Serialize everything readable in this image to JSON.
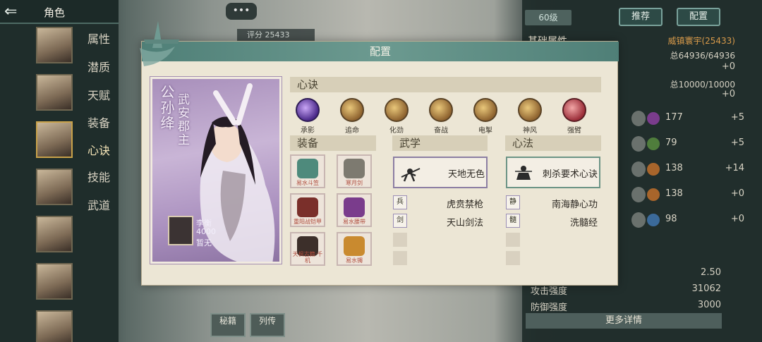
{
  "topbar": {
    "title": "角色",
    "back_icon": "back-arrow-icon"
  },
  "sidebar": {
    "tabs": [
      "属性",
      "潜质",
      "天赋",
      "装备",
      "心诀",
      "技能",
      "武道"
    ]
  },
  "chat_button": "•••",
  "score_text": "评分 25433",
  "level_text": "60级",
  "top_buttons": {
    "recommend": "推荐",
    "config": "配置"
  },
  "stats_panel": {
    "base_heading": "基础属性",
    "realm": "威镇寰宇(25433)",
    "hp_line": "总64936/64936",
    "hp_delta": "+0",
    "mp_line": "总10000/10000",
    "mp_delta": "+0",
    "rows": [
      {
        "icon": "剑法",
        "gem": "绝",
        "value": "177",
        "delta": "+5",
        "color": "#7a3c8c"
      },
      {
        "icon": "奇门",
        "gem": "两",
        "value": "79",
        "delta": "+5",
        "color": "#4f7d3c"
      },
      {
        "icon": "拳法",
        "gem": "巾",
        "value": "138",
        "delta": "+14",
        "color": "#a8652b"
      },
      {
        "icon": "福缘",
        "gem": "巾",
        "value": "138",
        "delta": "+0",
        "color": "#a8652b"
      },
      {
        "icon": "定力",
        "gem": "乙",
        "value": "98",
        "delta": "+0",
        "color": "#3b6a9a"
      }
    ],
    "crit_value": "2.50",
    "attack_label": "攻击强度",
    "attack_value": "31062",
    "defense_label": "防御强度",
    "defense_value": "3000",
    "more_detail": "更多详情"
  },
  "bottom_tabs": [
    "秘籍",
    "列传"
  ],
  "modal": {
    "title": "配置",
    "character": {
      "name": "公孙绛",
      "title": "武安郡主",
      "pet_name": "李衡",
      "pet_power": "4000",
      "pet_status": "暂无"
    },
    "xinjue_heading": "心诀",
    "skills": [
      {
        "label": "承影",
        "style": "purple"
      },
      {
        "label": "追命",
        "style": "gold"
      },
      {
        "label": "化劲",
        "style": "gold"
      },
      {
        "label": "奋战",
        "style": "gold"
      },
      {
        "label": "电掣",
        "style": "gold"
      },
      {
        "label": "神风",
        "style": "gold"
      },
      {
        "label": "强臂",
        "style": "red"
      }
    ],
    "equip_heading": "装备",
    "equipment": [
      {
        "label": "易水斗笠",
        "color": "#4e8a7c"
      },
      {
        "label": "寒月剑",
        "color": "#7d7a70"
      },
      {
        "label": "重阳战铠甲",
        "color": "#7a2f2a"
      },
      {
        "label": "易水腰带",
        "color": "#7a3c8c"
      },
      {
        "label": "天枫古籍·千机",
        "color": "#3c2f2a"
      },
      {
        "label": "易水镯",
        "color": "#c98a2f"
      }
    ],
    "wuxue_heading": "武学",
    "wuxue_main": "天地无色",
    "wuxue_subs": [
      "虎贲禁枪",
      "天山剑法"
    ],
    "xinfa_heading": "心法",
    "xinfa_main": "刺杀要术心诀",
    "xinfa_subs": [
      "南海静心功",
      "洗髓经"
    ]
  }
}
